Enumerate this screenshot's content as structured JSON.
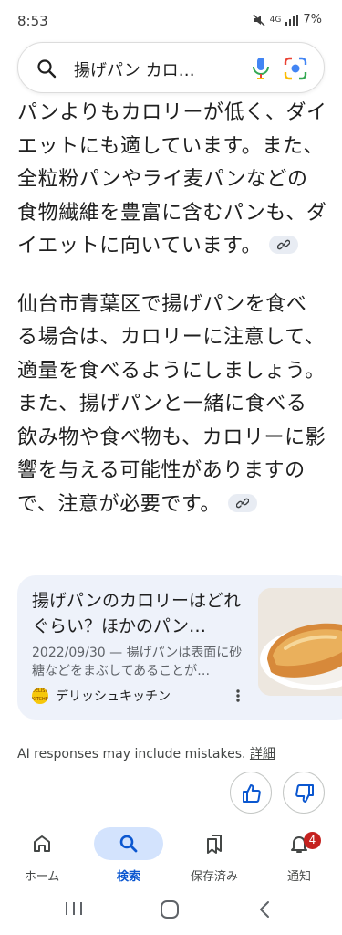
{
  "status_bar": {
    "time": "8:53",
    "network": "4G",
    "battery": "7%"
  },
  "search": {
    "query": "揚げパン カロ…"
  },
  "answer": {
    "paragraph1": "パンよりもカロリーが低く、ダイエットにも適しています。また、全粒粉パンやライ麦パンなどの食物繊維を豊富に含むパンも、ダイエットに向いています。",
    "paragraph2": "仙台市青葉区で揚げパンを食べる場合は、カロリーに注意して、適量を食べるようにしましょう。また、揚げパンと一緒に食べる飲み物や食べ物も、カロリーに影響を与える可能性がありますので、注意が必要です。"
  },
  "source_card": {
    "title": "揚げパンのカロリーはどれぐらい？ほかのパン…",
    "snippet": "2022/09/30 — 揚げパンは表面に砂糖などをまぶしてあることが…",
    "source_name": "デリッシュキッチン",
    "logo_text": "DELISH KITCHEN"
  },
  "disclaimer": {
    "text": "AI responses may include mistakes.",
    "link": "詳細"
  },
  "bottom_nav": {
    "items": [
      {
        "label": "ホーム",
        "icon": "home-icon"
      },
      {
        "label": "検索",
        "icon": "search-icon",
        "active": true
      },
      {
        "label": "保存済み",
        "icon": "bookmarks-icon"
      },
      {
        "label": "通知",
        "icon": "bell-icon",
        "badge": "4"
      }
    ]
  },
  "colors": {
    "accent": "#0b57d0",
    "active_pill": "#d3e3fd",
    "card_background": "#eef2fa",
    "badge": "#c5221f"
  }
}
